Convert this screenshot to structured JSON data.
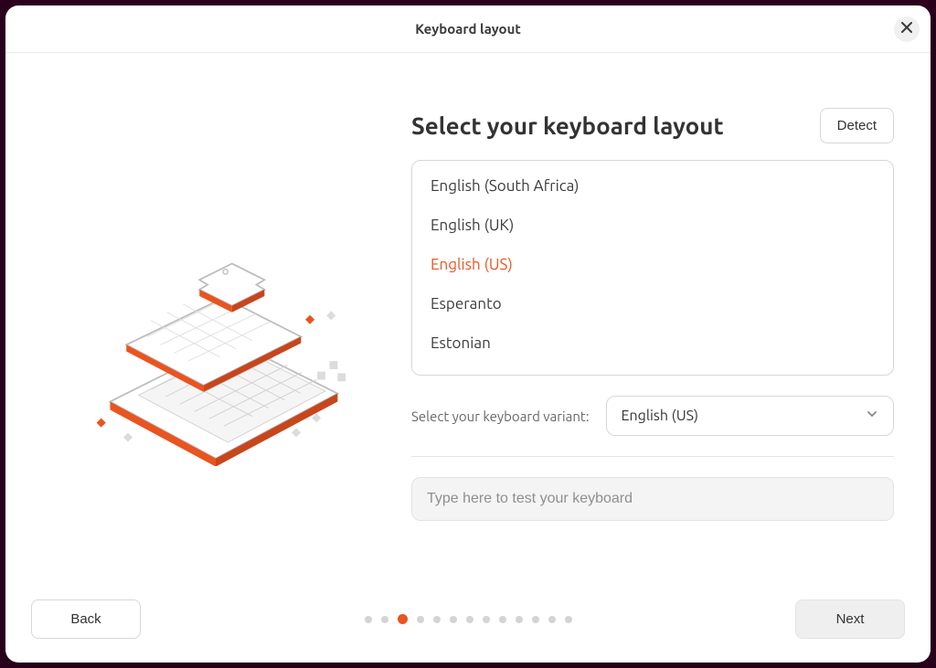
{
  "window": {
    "title": "Keyboard layout"
  },
  "main": {
    "heading": "Select your keyboard layout",
    "detect_label": "Detect",
    "layouts": {
      "items": [
        {
          "label": "English (South Africa)",
          "selected": false
        },
        {
          "label": "English (UK)",
          "selected": false
        },
        {
          "label": "English (US)",
          "selected": true
        },
        {
          "label": "Esperanto",
          "selected": false
        },
        {
          "label": "Estonian",
          "selected": false
        }
      ]
    },
    "variant": {
      "label": "Select your keyboard variant:",
      "value": "English (US)"
    },
    "test": {
      "placeholder": "Type here to test your keyboard"
    }
  },
  "footer": {
    "back_label": "Back",
    "next_label": "Next",
    "steps": {
      "total": 13,
      "active_index": 2
    }
  },
  "colors": {
    "accent": "#e95420"
  },
  "icons": {
    "close": "close-icon",
    "chevron_down": "chevron-down-icon",
    "keyboard_illustration": "keyboard-illustration"
  }
}
